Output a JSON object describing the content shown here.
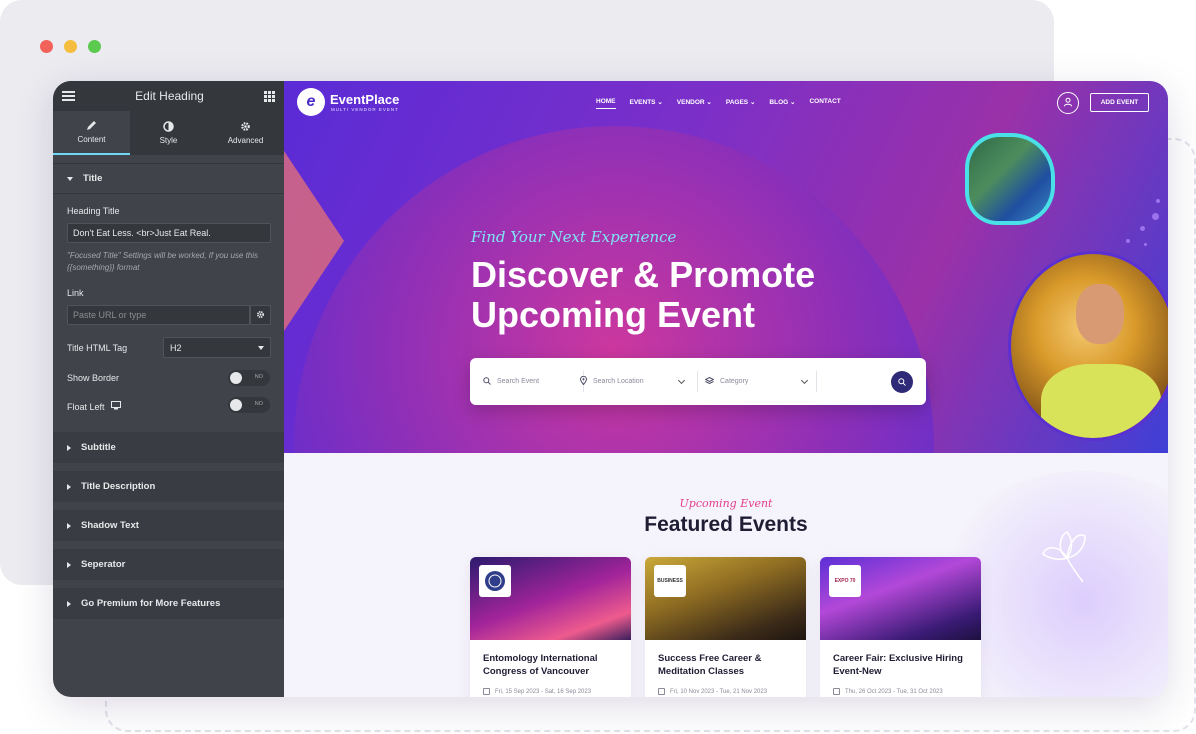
{
  "panel": {
    "title": "Edit Heading",
    "tabs": [
      {
        "label": "Content"
      },
      {
        "label": "Style"
      },
      {
        "label": "Advanced"
      }
    ],
    "section_title": "Title",
    "heading_title_label": "Heading Title",
    "heading_title_value": "Don't Eat Less. <br>Just Eat Real.",
    "note": "\"Focused Title\" Settings will be worked, If you use this {{something}} format",
    "link_label": "Link",
    "link_placeholder": "Paste URL or type",
    "html_tag_label": "Title HTML Tag",
    "html_tag_value": "H2",
    "show_border_label": "Show Border",
    "show_border_value": "NO",
    "float_left_label": "Float Left",
    "float_left_value": "NO",
    "sections": [
      {
        "label": "Subtitle"
      },
      {
        "label": "Title Description"
      },
      {
        "label": "Shadow Text"
      },
      {
        "label": "Seperator"
      },
      {
        "label": "Go Premium for More Features"
      }
    ]
  },
  "site": {
    "logo_name": "EventPlace",
    "logo_sub": "MULTI VENDOR EVENT",
    "nav": [
      {
        "label": "HOME"
      },
      {
        "label": "EVENTS"
      },
      {
        "label": "VENDOR"
      },
      {
        "label": "PAGES"
      },
      {
        "label": "BLOG"
      },
      {
        "label": "CONTACT"
      }
    ],
    "add_event": "ADD EVENT",
    "eyebrow": "Find Your Next Experience",
    "hero_title_line1": "Discover & Promote",
    "hero_title_line2": "Upcoming Event",
    "search": {
      "event_placeholder": "Search Event",
      "location_placeholder": "Search Location",
      "category_placeholder": "Category"
    },
    "featured_eyebrow": "Upcoming Event",
    "featured_title": "Featured Events",
    "cards": [
      {
        "badge": "",
        "title": "Entomology International Congress of Vancouver",
        "date": "Fri, 15 Sep 2023 - Sat, 16 Sep 2023"
      },
      {
        "badge": "BUSINESS",
        "title": "Success Free Career & Meditation Classes",
        "date": "Fri, 10 Nov 2023 - Tue, 21 Nov 2023"
      },
      {
        "badge": "EXPO 70",
        "title": "Career Fair: Exclusive Hiring Event-New",
        "date": "Thu, 26 Oct 2023 - Tue, 31 Oct 2023"
      }
    ]
  },
  "colors": {
    "panel_bg": "#404349",
    "accent_cyan": "#71d7f7",
    "hero_purple": "#5a2bd6",
    "eyebrow_pink": "#e23d8a"
  }
}
